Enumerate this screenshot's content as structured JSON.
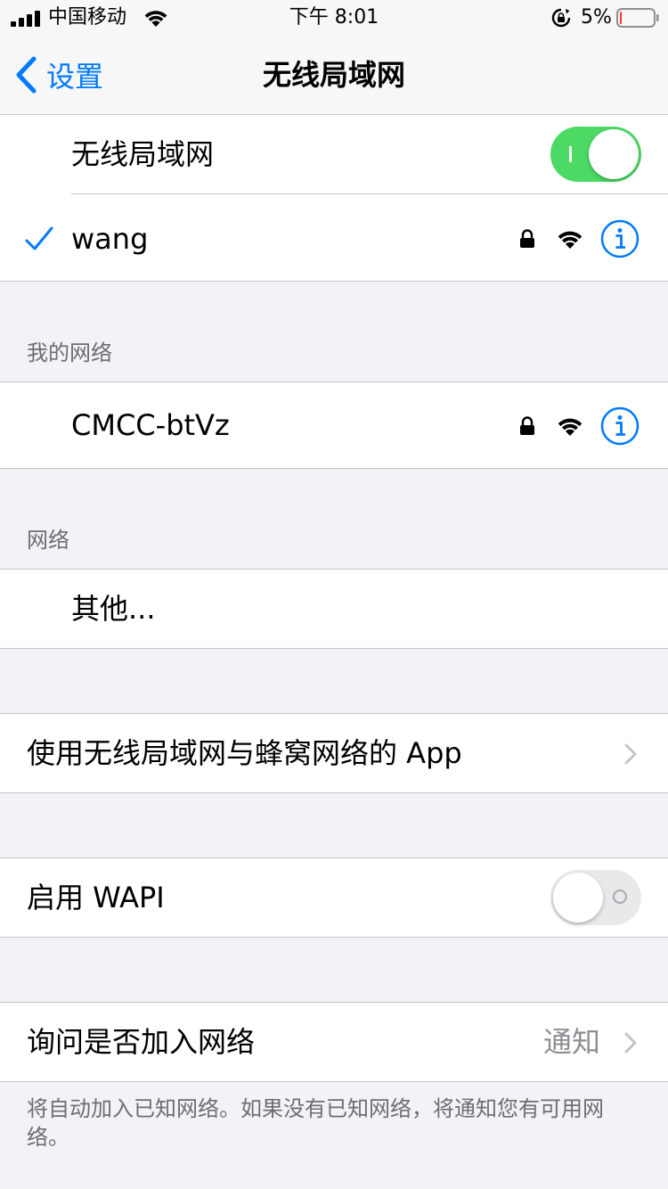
{
  "status_bar": {
    "carrier": "中国移动",
    "time": "下午 8:01",
    "battery_percent": "5%",
    "battery_level": 0.05
  },
  "nav": {
    "back_label": "设置",
    "title": "无线局域网"
  },
  "wifi_toggle": {
    "label": "无线局域网",
    "on": true
  },
  "connected_network": {
    "name": "wang",
    "connected": true,
    "secured": true
  },
  "my_networks": {
    "header": "我的网络",
    "items": [
      {
        "name": "CMCC-btVz",
        "secured": true
      }
    ]
  },
  "networks": {
    "header": "网络",
    "other_label": "其他..."
  },
  "apps_row": {
    "label": "使用无线局域网与蜂窝网络的 App"
  },
  "wapi": {
    "label": "启用 WAPI",
    "on": false
  },
  "ask_to_join": {
    "label": "询问是否加入网络",
    "value": "通知",
    "footer": "将自动加入已知网络。如果没有已知网络，将通知您有可用网络。"
  },
  "colors": {
    "accent": "#007aff",
    "toggle_on": "#4cd964",
    "background": "#f2f2f7",
    "battery_low": "#ff3b30"
  },
  "icons": {
    "back": "chevron-left-icon",
    "check": "checkmark-icon",
    "lock": "lock-icon",
    "wifi": "wifi-icon",
    "info": "info-icon",
    "disclosure": "chevron-right-icon"
  }
}
